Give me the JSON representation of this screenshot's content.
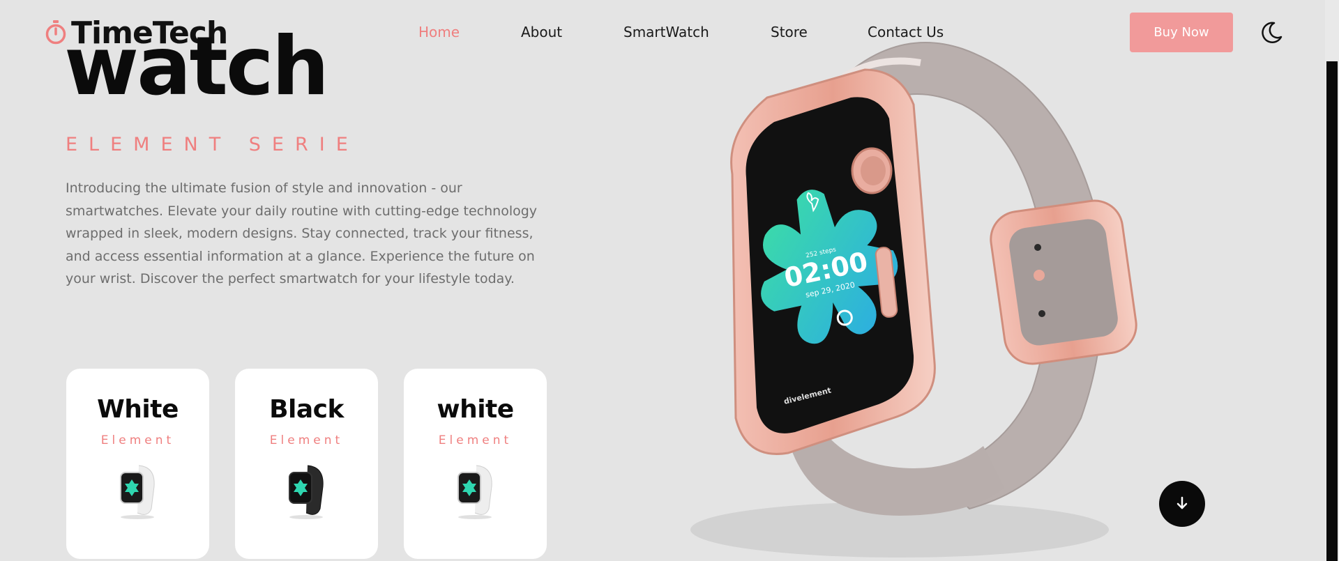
{
  "brand": {
    "name": "TimeTech",
    "icon": "stopwatch-icon",
    "accent": "#ef7f7f"
  },
  "nav": {
    "items": [
      {
        "label": "Home",
        "active": true
      },
      {
        "label": "About"
      },
      {
        "label": "SmartWatch"
      },
      {
        "label": "Store"
      },
      {
        "label": "Contact Us"
      }
    ]
  },
  "header": {
    "buy_label": "Buy Now",
    "theme_icon": "moon-icon"
  },
  "hero": {
    "title": "watch",
    "subtitle": "ELEMENT SERIE",
    "description": "Introducing the ultimate fusion of style and innovation - our smartwatches. Elevate your daily routine with cutting-edge technology wrapped in sleek, modern designs. Stay connected, track your fitness, and access essential information at a glance. Experience the future on your wrist. Discover the perfect smartwatch for your lifestyle today."
  },
  "cards": [
    {
      "title": "White",
      "subtitle": "Element",
      "band": "#eeeeee"
    },
    {
      "title": "Black",
      "subtitle": "Element",
      "band": "#2a2a2a"
    },
    {
      "title": "white",
      "subtitle": "Element",
      "band": "#eeeeee"
    }
  ],
  "watch_face": {
    "steps": "252 steps",
    "time": "02:00",
    "date": "sep 29, 2020",
    "label": "divelement"
  },
  "scroll_icon": "arrow-down-icon",
  "colors": {
    "background": "#e4e4e4",
    "button": "#f19a9a",
    "case": "#e8a89a",
    "strap": "#b7adab"
  }
}
